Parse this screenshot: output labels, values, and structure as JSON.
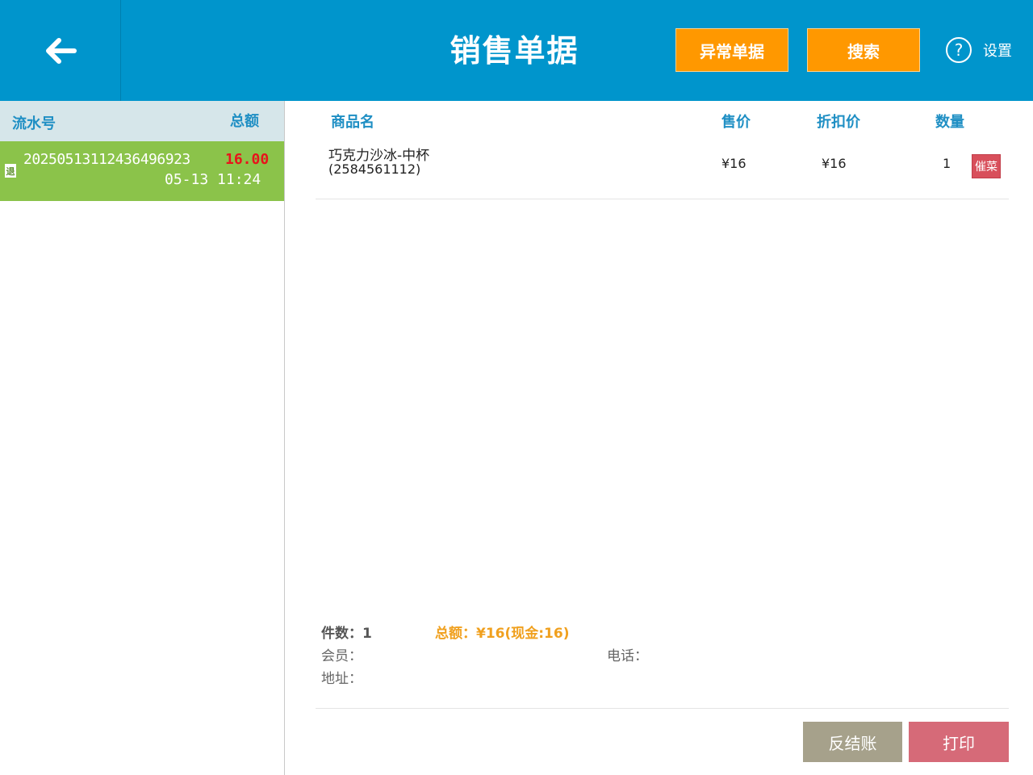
{
  "header": {
    "title": "销售单据",
    "abnormal_button": "异常单据",
    "search_button": "搜索",
    "help_symbol": "?",
    "settings_label": "设置"
  },
  "order_list": {
    "header": {
      "serial_label": "流水号",
      "total_label": "总额"
    },
    "orders": [
      {
        "refund_badge": "退",
        "order_no": "20250513112436496923",
        "amount": "16.00",
        "time": "05-13 11:24"
      }
    ]
  },
  "detail": {
    "columns": {
      "name": "商品名",
      "price": "售价",
      "discount": "折扣价",
      "quantity": "数量"
    },
    "items": [
      {
        "name": "巧克力沙冰-中杯",
        "code": "(2584561112)",
        "price": "¥16",
        "discount_price": "¥16",
        "quantity": "1",
        "rush_label": "催菜"
      }
    ],
    "summary": {
      "count": "件数：1",
      "total": "总额：¥16(现金:16)",
      "member": "会员：",
      "phone": "电话：",
      "address": "地址："
    },
    "buttons": {
      "unsettle": "反结账",
      "print": "打印"
    }
  },
  "colors": {
    "topbar": "#0095cc",
    "orange": "#ff9800",
    "selected_row": "#8bc34a",
    "amount_red": "#e8141b",
    "accent_blue": "#1f8fc4",
    "total_orange": "#f0a01e",
    "print_button": "#d66a78",
    "unsettle_button": "#a6a18b"
  },
  "icons": {
    "back": "arrow-left-icon",
    "help": "question-circle-icon",
    "refund": "refund-doc-icon"
  }
}
